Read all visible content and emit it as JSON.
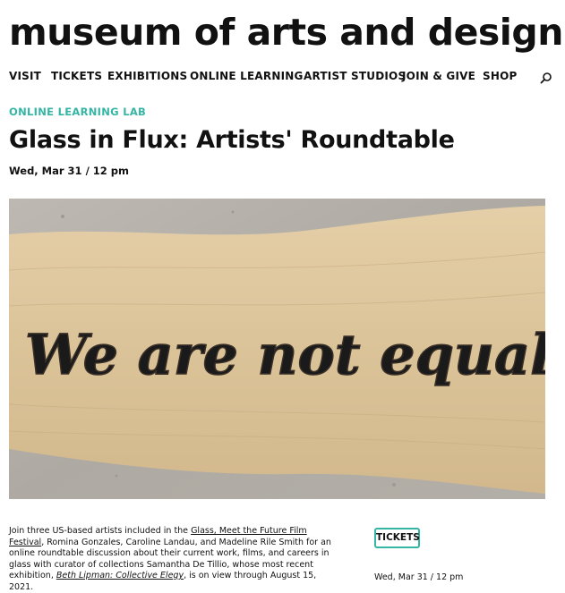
{
  "site": {
    "title": "museum of arts and design"
  },
  "nav": {
    "items": [
      "VISIT",
      "TICKETS",
      "EXHIBITIONS",
      "ONLINE LEARNING",
      "ARTIST STUDIOS",
      "JOIN & GIVE",
      "SHOP"
    ],
    "search_icon": "search-icon"
  },
  "event": {
    "category": "ONLINE LEARNING LAB",
    "title": "Glass in Flux: Artists' Roundtable",
    "date": "Wed, Mar 31 / 12 pm",
    "image_text": "We are not equal",
    "description": {
      "p1": "Join three US-based artists included in the ",
      "link1": "Glass, Meet the Future Film Festival",
      "p2": ", Romina Gonzales, Caroline Landau, and Madeline Rile Smith for an online roundtable discussion about their current work, films, and careers in glass with curator of collections Samantha De Tillio, whose most recent exhibition, ",
      "link2": "Beth Lipman: Collective Elegy",
      "p3": ", is on view through August 15, 2021."
    }
  },
  "sidebar": {
    "tickets_label": "TICKETS",
    "date": "Wed, Mar 31 / 12 pm"
  },
  "colors": {
    "accent": "#35b5a4",
    "text": "#111111"
  }
}
